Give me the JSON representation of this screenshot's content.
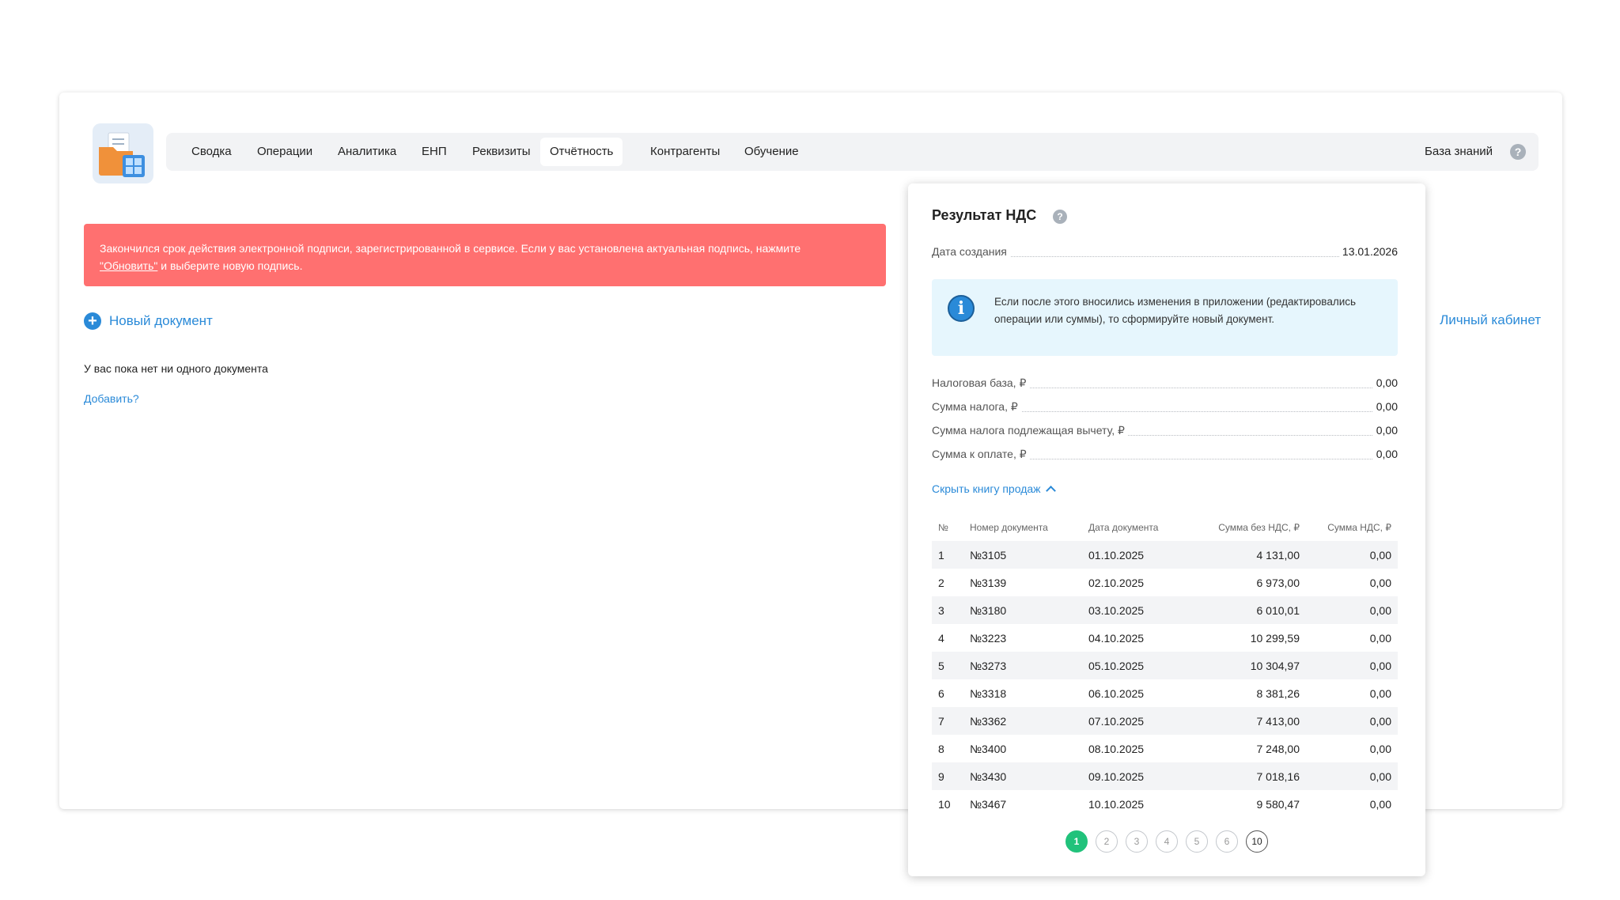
{
  "nav": {
    "items": [
      {
        "label": "Сводка",
        "left": 0
      },
      {
        "label": "Операции"
      },
      {
        "label": "Аналитика"
      },
      {
        "label": "ЕНП"
      },
      {
        "label": "Реквизиты"
      },
      {
        "label": "Отчётность"
      },
      {
        "label": "Контрагенты"
      },
      {
        "label": "Обучение"
      }
    ],
    "active": "Отчётность",
    "knowledge_base": "База знаний",
    "help": "?"
  },
  "alert": {
    "text_before": "Закончился срок действия электронной подписи, зарегистрированной в сервисе. Если у вас установлена актуальная подпись, нажмите",
    "link": "\"Обновить\"",
    "text_after": "и выберите новую подпись."
  },
  "main": {
    "new_document": "Новый документ",
    "empty_text": "У вас пока нет ни одного документа",
    "add_link": "Добавить?",
    "cabinet_link": "Личный кабинет"
  },
  "panel": {
    "title": "Результат НДС",
    "help": "?",
    "created_label": "Дата создания",
    "created_value": "13.01.2026",
    "info_icon": "i",
    "info_text": "Если после этого вносились изменения в приложении (редактировались операции или суммы), то сформируйте новый документ.",
    "summary": [
      {
        "label": "Налоговая база, ₽",
        "value": "0,00"
      },
      {
        "label": "Сумма налога, ₽",
        "value": "0,00"
      },
      {
        "label": "Сумма налога подлежащая вычету, ₽",
        "value": "0,00"
      },
      {
        "label": "Сумма к оплате, ₽",
        "value": "0,00"
      }
    ],
    "toggle_label": "Скрыть книгу продаж",
    "table": {
      "headers": [
        "№",
        "Номер документа",
        "Дата документа",
        "Сумма без НДС, ₽",
        "Сумма НДС, ₽"
      ],
      "rows": [
        [
          "1",
          "№3105",
          "01.10.2025",
          "4 131,00",
          "0,00"
        ],
        [
          "2",
          "№3139",
          "02.10.2025",
          "6 973,00",
          "0,00"
        ],
        [
          "3",
          "№3180",
          "03.10.2025",
          "6 010,01",
          "0,00"
        ],
        [
          "4",
          "№3223",
          "04.10.2025",
          "10 299,59",
          "0,00"
        ],
        [
          "5",
          "№3273",
          "05.10.2025",
          "10 304,97",
          "0,00"
        ],
        [
          "6",
          "№3318",
          "06.10.2025",
          "8 381,26",
          "0,00"
        ],
        [
          "7",
          "№3362",
          "07.10.2025",
          "7 413,00",
          "0,00"
        ],
        [
          "8",
          "№3400",
          "08.10.2025",
          "7 248,00",
          "0,00"
        ],
        [
          "9",
          "№3430",
          "09.10.2025",
          "7 018,16",
          "0,00"
        ],
        [
          "10",
          "№3467",
          "10.10.2025",
          "9 580,47",
          "0,00"
        ]
      ]
    },
    "pages": [
      "1",
      "2",
      "3",
      "4",
      "5",
      "6",
      "10"
    ],
    "active_page": "1"
  },
  "colors": {
    "accent": "#2a8ad8",
    "alert": "#ff7070",
    "pager_active": "#21c27b",
    "info_bg": "#e6f6fd"
  }
}
